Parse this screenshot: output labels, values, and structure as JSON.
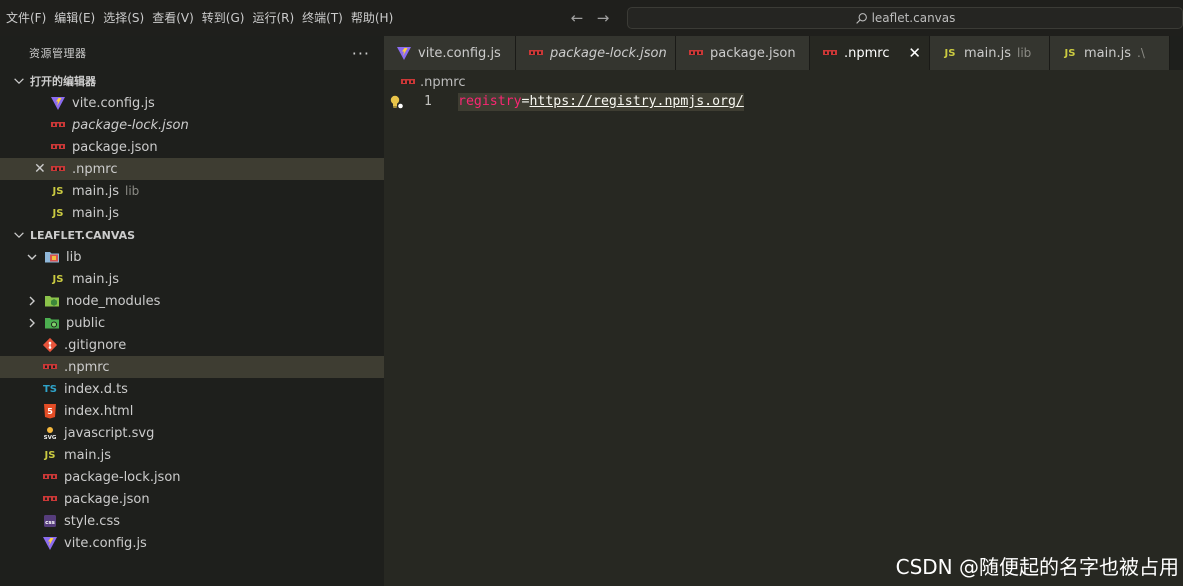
{
  "menu": [
    "文件(F)",
    "编辑(E)",
    "选择(S)",
    "查看(V)",
    "转到(G)",
    "运行(R)",
    "终端(T)",
    "帮助(H)"
  ],
  "command_center": {
    "text": "leaflet.canvas"
  },
  "explorer": {
    "title": "资源管理器",
    "more": "···",
    "open_editors": {
      "header": "打开的编辑器",
      "items": [
        {
          "label": "vite.config.js",
          "icon": "vite-icon"
        },
        {
          "label": "package-lock.json",
          "icon": "npm-icon",
          "italic": true
        },
        {
          "label": "package.json",
          "icon": "npm-icon"
        },
        {
          "label": ".npmrc",
          "icon": "npm-icon",
          "selected": true
        },
        {
          "label": "main.js",
          "description": "lib",
          "icon": "js-icon"
        },
        {
          "label": "main.js",
          "icon": "js-icon"
        }
      ]
    },
    "workspace": {
      "header": "LEAFLET.CANVAS",
      "items": [
        {
          "label": "lib",
          "icon": "folder-lib-icon",
          "expanded": true,
          "level": 0,
          "folder": true
        },
        {
          "label": "main.js",
          "icon": "js-icon",
          "level": 1
        },
        {
          "label": "node_modules",
          "icon": "folder-node-icon",
          "expanded": false,
          "level": 0,
          "folder": true
        },
        {
          "label": "public",
          "icon": "folder-public-icon",
          "expanded": false,
          "level": 0,
          "folder": true
        },
        {
          "label": ".gitignore",
          "icon": "git-icon",
          "level": 0
        },
        {
          "label": ".npmrc",
          "icon": "npm-icon",
          "level": 0,
          "selected": true
        },
        {
          "label": "index.d.ts",
          "icon": "ts-icon",
          "level": 0
        },
        {
          "label": "index.html",
          "icon": "html-icon",
          "level": 0
        },
        {
          "label": "javascript.svg",
          "icon": "svg-icon",
          "level": 0
        },
        {
          "label": "main.js",
          "icon": "js-icon",
          "level": 0
        },
        {
          "label": "package-lock.json",
          "icon": "npm-icon",
          "level": 0
        },
        {
          "label": "package.json",
          "icon": "npm-icon",
          "level": 0
        },
        {
          "label": "style.css",
          "icon": "css-icon",
          "level": 0
        },
        {
          "label": "vite.config.js",
          "icon": "vite-icon",
          "level": 0
        }
      ]
    }
  },
  "tabs": [
    {
      "label": "vite.config.js",
      "icon": "vite-icon"
    },
    {
      "label": "package-lock.json",
      "icon": "npm-icon",
      "italic": true
    },
    {
      "label": "package.json",
      "icon": "npm-icon"
    },
    {
      "label": ".npmrc",
      "icon": "npm-icon",
      "active": true
    },
    {
      "label": "main.js",
      "description": "lib",
      "icon": "js-icon"
    },
    {
      "label": "main.js",
      "description": ".\\",
      "icon": "js-icon"
    }
  ],
  "editor": {
    "breadcrumb": ".npmrc",
    "line_number": "1",
    "code_key": "registry",
    "code_eq": "=",
    "code_value": "https://registry.npmjs.org/"
  },
  "watermark": "CSDN @随便起的名字也被占用",
  "colors": {
    "accent_key": "#f92672",
    "js": "#cbcb41",
    "npm": "#cb3837",
    "ts": "#2fa3c9",
    "html": "#e44d26",
    "css": "#563d7c"
  }
}
